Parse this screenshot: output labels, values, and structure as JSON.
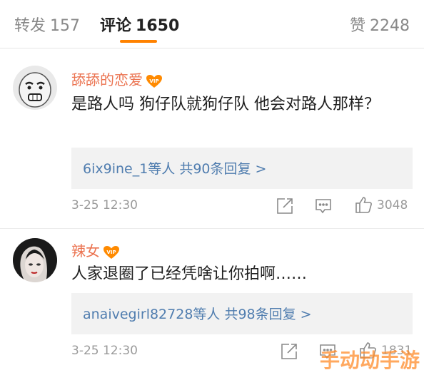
{
  "tabs": {
    "repost": {
      "label": "转发",
      "count": "157"
    },
    "comments": {
      "label": "评论",
      "count": "1650"
    },
    "likes": {
      "label": "赞",
      "count": "2248"
    }
  },
  "comments": [
    {
      "username": "舔舔的恋爱",
      "text": "是路人吗  狗仔队就狗仔队  他会对路人那样？",
      "reply_summary": "6ix9ine_1等人  共90条回复 >",
      "timestamp": "3-25 12:30",
      "likes": "3048"
    },
    {
      "username": "辣女",
      "text": "人家退圈了已经凭啥让你拍啊……",
      "reply_summary": "anaivegirl82728等人  共98条回复 >",
      "timestamp": "3-25 12:30",
      "likes": "1831"
    }
  ],
  "watermark": "手动动手游",
  "colors": {
    "accent": "#ff8200",
    "username": "#eb7350",
    "link": "#507daf",
    "muted": "#9a9a9a"
  },
  "icons": [
    "forward-icon",
    "comment-icon",
    "thumbs-up-icon",
    "vip-badge-icon"
  ]
}
